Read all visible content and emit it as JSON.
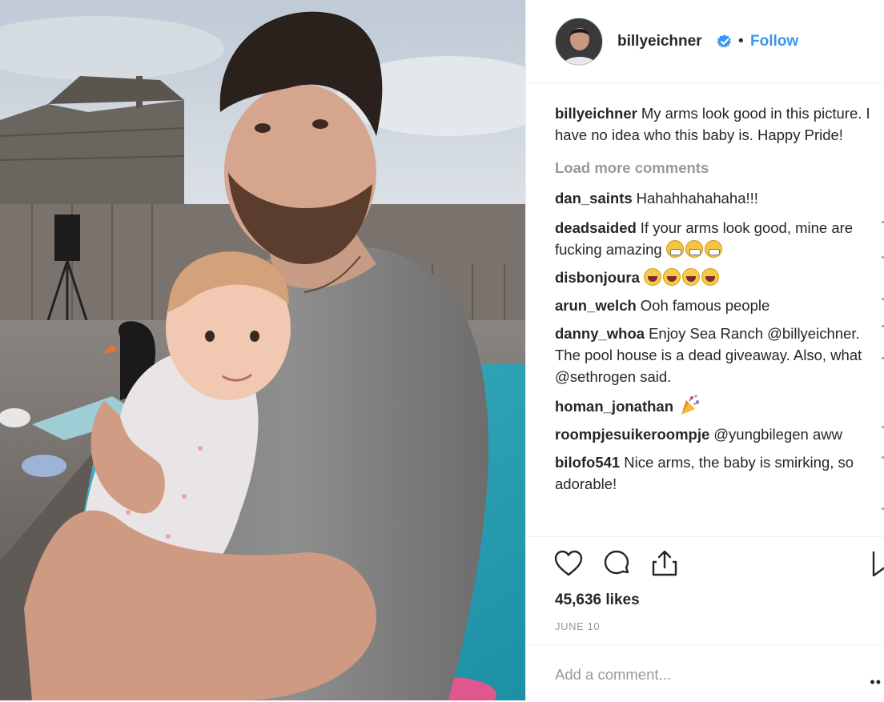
{
  "post": {
    "username": "billyeichner",
    "follow_label": "Follow",
    "separator": "•",
    "caption": {
      "username": "billyeichner",
      "text": "My arms look good in this picture. I have no idea who this baby is. Happy Pride!"
    },
    "load_more_label": "Load more comments",
    "comments": [
      {
        "username": "dan_saints",
        "text": "Hahahhahahaha!!!"
      },
      {
        "username": "deadsaided",
        "text": "If your arms look good, mine are fucking amazing",
        "emoji": [
          "grimacing-face",
          "grimacing-face",
          "grimacing-face"
        ]
      },
      {
        "username": "disbonjoura",
        "text": "",
        "emoji": [
          "tears-of-joy",
          "tears-of-joy",
          "tears-of-joy",
          "tears-of-joy"
        ]
      },
      {
        "username": "arun_welch",
        "text": "Ooh famous people"
      },
      {
        "username": "danny_whoa",
        "text": "Enjoy Sea Ranch @billyeichner. The pool house is a dead giveaway. Also, what @sethrogen said."
      },
      {
        "username": "homan_jonathan",
        "text": "",
        "emoji": [
          "party-popper"
        ]
      },
      {
        "username": "roompjesuikeroompje",
        "text": "@yungbilegen aww"
      },
      {
        "username": "bilofo541",
        "text": "Nice arms, the baby is smirking, so adorable!"
      }
    ],
    "likes": "45,636 likes",
    "date": "JUNE 10",
    "add_comment_placeholder": "Add a comment...",
    "more_options": "••"
  },
  "colors": {
    "link_blue": "#3897f0",
    "text": "#262626",
    "muted": "#999999",
    "divider": "#efefef"
  },
  "icons": [
    "verified-badge-icon",
    "heart-icon",
    "comment-icon",
    "share-icon",
    "bookmark-icon"
  ]
}
